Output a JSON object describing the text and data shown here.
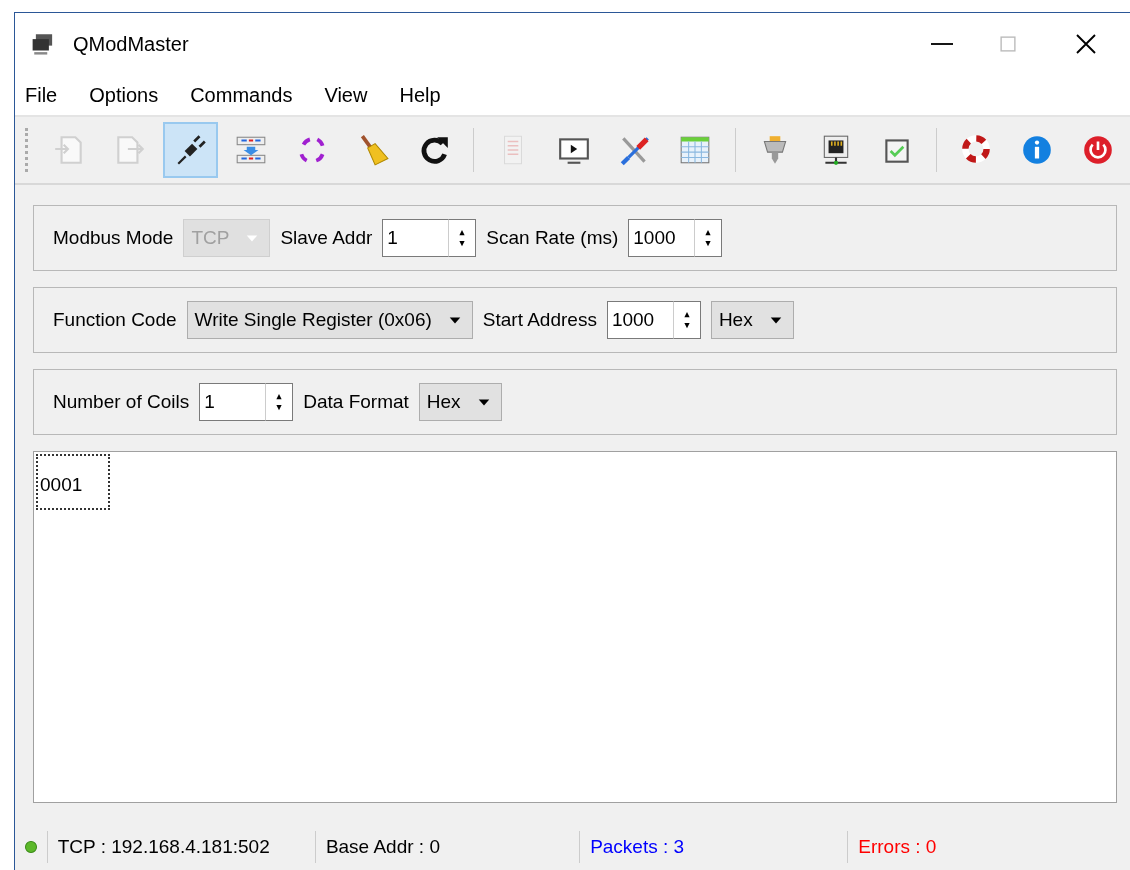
{
  "window": {
    "title": "QModMaster"
  },
  "menu": [
    {
      "label": "File"
    },
    {
      "label": "Options"
    },
    {
      "label": "Commands"
    },
    {
      "label": "View"
    },
    {
      "label": "Help"
    }
  ],
  "toolbar": [
    {
      "kind": "open",
      "disabled": true,
      "checked": false
    },
    {
      "kind": "export",
      "disabled": true,
      "checked": false
    },
    {
      "kind": "plug",
      "disabled": false,
      "checked": true
    },
    {
      "kind": "bus",
      "disabled": false,
      "checked": false
    },
    {
      "kind": "cycle",
      "disabled": false,
      "checked": false
    },
    {
      "kind": "broom",
      "disabled": false,
      "checked": false
    },
    {
      "kind": "refresh",
      "disabled": false,
      "checked": false
    },
    {
      "kind": "separator"
    },
    {
      "kind": "log",
      "disabled": true,
      "checked": false
    },
    {
      "kind": "monitor",
      "disabled": false,
      "checked": false
    },
    {
      "kind": "tools",
      "disabled": false,
      "checked": false
    },
    {
      "kind": "table",
      "disabled": false,
      "checked": false
    },
    {
      "kind": "separator"
    },
    {
      "kind": "serial",
      "disabled": false,
      "checked": false
    },
    {
      "kind": "network",
      "disabled": false,
      "checked": false
    },
    {
      "kind": "checkbox",
      "disabled": false,
      "checked": false
    },
    {
      "kind": "separator"
    },
    {
      "kind": "lifebuoy",
      "disabled": false,
      "checked": false
    },
    {
      "kind": "info",
      "disabled": false,
      "checked": false
    },
    {
      "kind": "power",
      "disabled": false,
      "checked": false
    }
  ],
  "groups": [
    {
      "fields": [
        {
          "kind": "label",
          "text": "Modbus Mode"
        },
        {
          "kind": "combo",
          "value": "TCP",
          "disabled": true
        },
        {
          "kind": "label",
          "text": "Slave Addr"
        },
        {
          "kind": "spin",
          "value": "1"
        },
        {
          "kind": "label",
          "text": "Scan Rate (ms)"
        },
        {
          "kind": "spin",
          "value": "1000"
        }
      ]
    },
    {
      "fields": [
        {
          "kind": "label",
          "text": "Function Code"
        },
        {
          "kind": "combo",
          "value": "Write Single Register (0x06)",
          "disabled": false
        },
        {
          "kind": "label",
          "text": "Start Address"
        },
        {
          "kind": "spin",
          "value": "1000"
        },
        {
          "kind": "combo",
          "value": "Hex",
          "disabled": false
        }
      ]
    },
    {
      "fields": [
        {
          "kind": "label",
          "text": "Number of Coils"
        },
        {
          "kind": "spin",
          "value": "1"
        },
        {
          "kind": "label",
          "text": "Data Format"
        },
        {
          "kind": "combo",
          "value": "Hex",
          "disabled": false
        }
      ]
    }
  ],
  "table": {
    "cells": [
      {
        "text": "0001",
        "selected": true
      }
    ]
  },
  "status_bar": {
    "connected": true,
    "items": [
      {
        "text": "TCP : 192.168.4.181:502",
        "color": "#000000"
      },
      {
        "text": "Base Addr : 0",
        "color": "#000000"
      },
      {
        "text": "Packets : 3",
        "color": "#0000ff"
      },
      {
        "text": "Errors : 0",
        "color": "#ff0000"
      }
    ]
  }
}
